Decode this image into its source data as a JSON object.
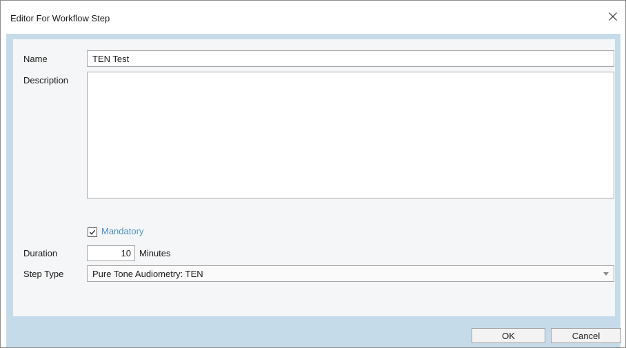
{
  "window": {
    "title": "Editor For Workflow Step",
    "close_icon": "close-icon"
  },
  "form": {
    "name_label": "Name",
    "name_value": "TEN Test",
    "description_label": "Description",
    "description_value": "",
    "mandatory_label": "Mandatory",
    "mandatory_checked": true,
    "duration_label": "Duration",
    "duration_value": "10",
    "duration_unit": "Minutes",
    "step_type_label": "Step Type",
    "step_type_value": "Pure Tone Audiometry: TEN"
  },
  "buttons": {
    "ok_label": "OK",
    "cancel_label": "Cancel"
  },
  "colors": {
    "frame": "#c6dbea",
    "panel": "#f5f6f7",
    "mandatory_text": "#4a90c8"
  }
}
